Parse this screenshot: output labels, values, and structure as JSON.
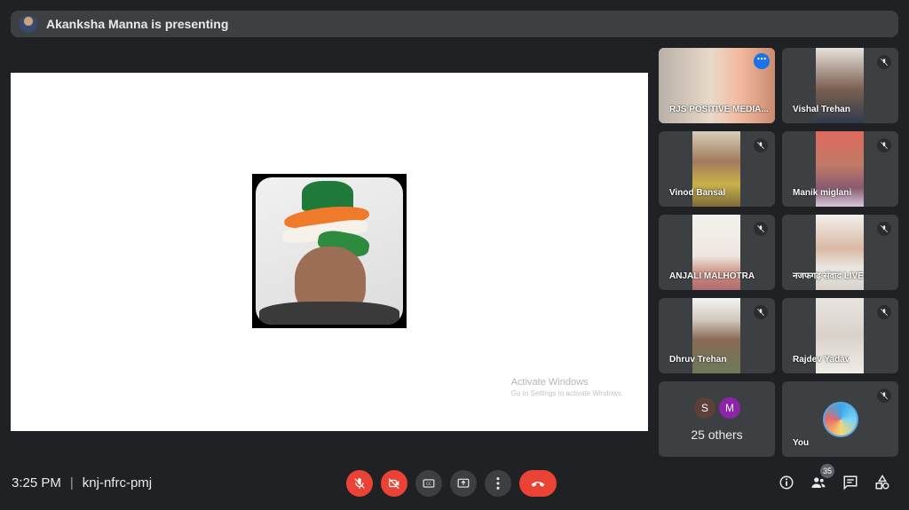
{
  "banner": {
    "text": "Akanksha Manna is presenting"
  },
  "watermark": {
    "line1": "Activate Windows",
    "line2": "Go to Settings to activate Windows."
  },
  "tiles": [
    {
      "name": "RJS POSITIVE MEDIA..."
    },
    {
      "name": "Vishal Trehan"
    },
    {
      "name": "Vinod Bansal"
    },
    {
      "name": "Manik miglani"
    },
    {
      "name": "ANJALI MALHOTRA"
    },
    {
      "name": "नजफगढ़ संवाद LIVE"
    },
    {
      "name": "Dhruv Trehan"
    },
    {
      "name": "Rajdev Yadav"
    }
  ],
  "others": {
    "initials": [
      "S",
      "M"
    ],
    "label": "25 others",
    "colors": [
      "#5d4037",
      "#8e24aa"
    ]
  },
  "self": {
    "name": "You"
  },
  "footer": {
    "time": "3:25 PM",
    "separator": "|",
    "meeting_code": "knj-nfrc-pmj",
    "participant_count": "35"
  },
  "colors": {
    "accent": "#8ab4f8",
    "danger": "#ea4335",
    "tile_bg": "#3c4043",
    "bg": "#202124"
  }
}
